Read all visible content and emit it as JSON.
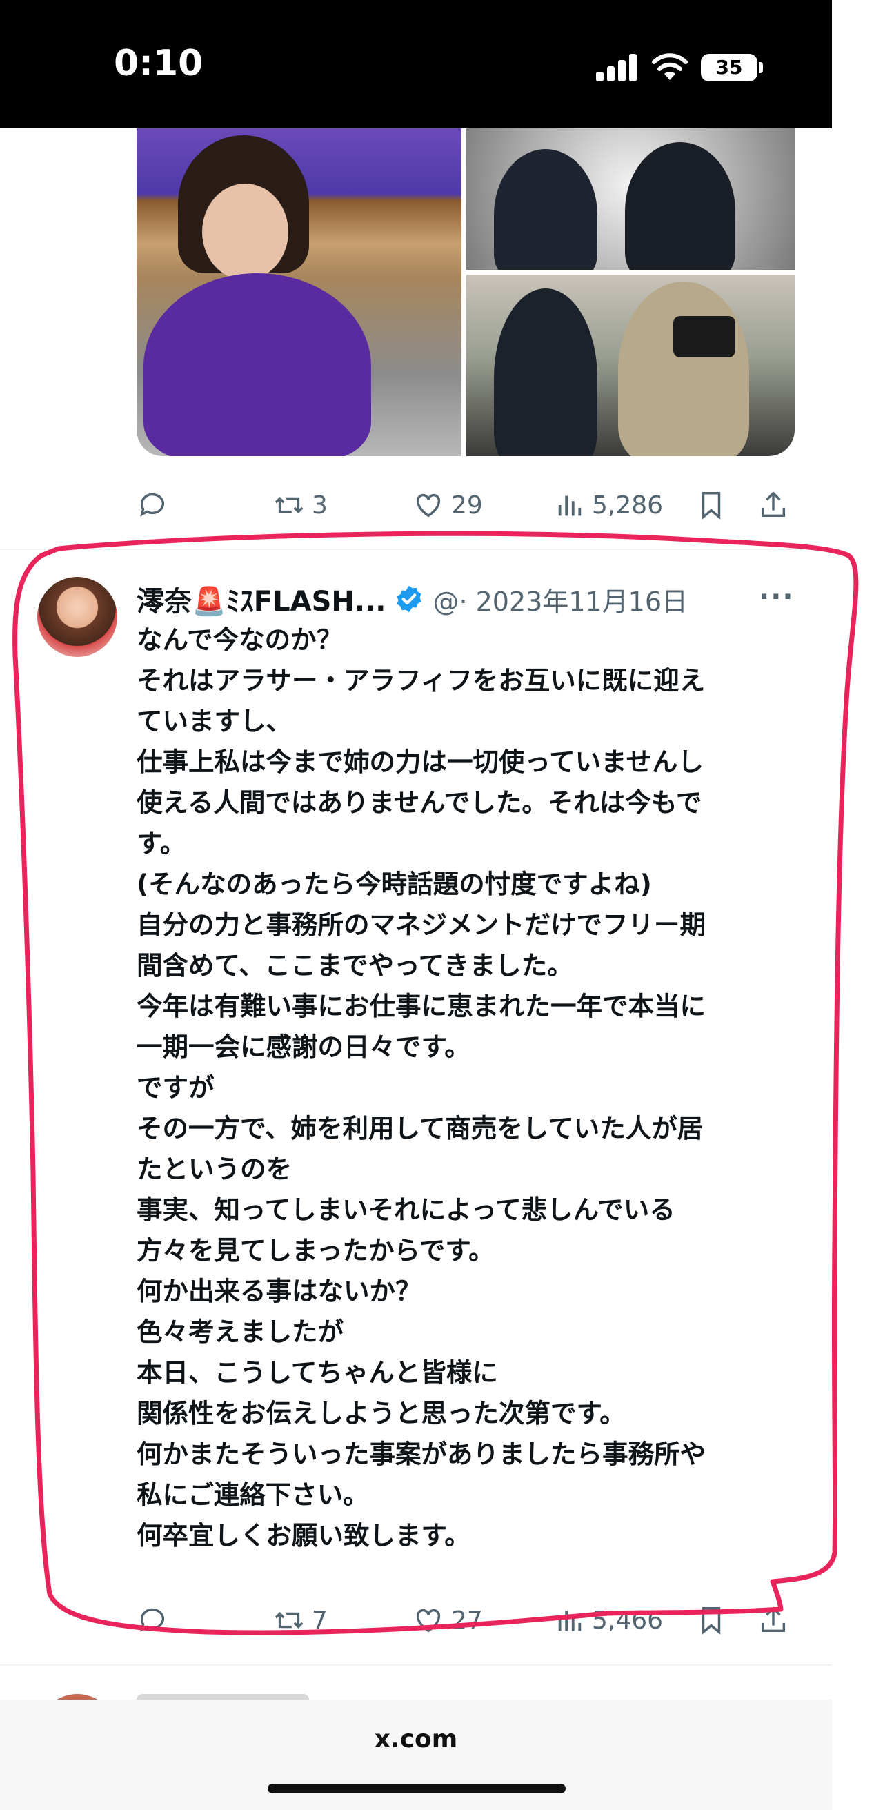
{
  "status_bar": {
    "time": "0:10",
    "battery": "35"
  },
  "previous_tweet": {
    "actions": {
      "reply_count": "",
      "retweet_count": "3",
      "like_count": "29",
      "views": "5,286"
    }
  },
  "tweet": {
    "author_name": "澪奈🚨ﾐｽFLASH...",
    "handle_date": "@· 2023年11月16日",
    "more": "···",
    "lines": [
      "なんで今なのか？",
      "それはアラサー・アラフィフをお互いに既に迎え",
      "ていますし、",
      "仕事上私は今まで姉の力は一切使っていませんし",
      "使える人間ではありませんでした。それは今もで",
      "す。",
      "(そんなのあったら今時話題の忖度ですよね)",
      "自分の力と事務所のマネジメントだけでフリー期",
      "間含めて、ここまでやってきました。",
      "今年は有難い事にお仕事に恵まれた一年で本当に",
      "一期一会に感謝の日々です。",
      "ですが",
      "その一方で、姉を利用して商売をしていた人が居",
      "たというのを",
      "事実、知ってしまいそれによって悲しんでいる",
      "方々を見てしまったからです。",
      "何か出来る事はないか？",
      "色々考えましたが",
      "本日、こうしてちゃんと皆様に",
      "関係性をお伝えしようと思った次第です。",
      "何かまたそういった事案がありましたら事務所や",
      "私にご連絡下さい。",
      "何卒宜しくお願い致します。"
    ],
    "actions": {
      "retweet_count": "7",
      "like_count": "27",
      "views": "5,466"
    }
  },
  "browser": {
    "url": "x.com"
  },
  "colors": {
    "annotation": "#e8245a",
    "verified": "#1d9bf0",
    "secondary_text": "#536471"
  }
}
